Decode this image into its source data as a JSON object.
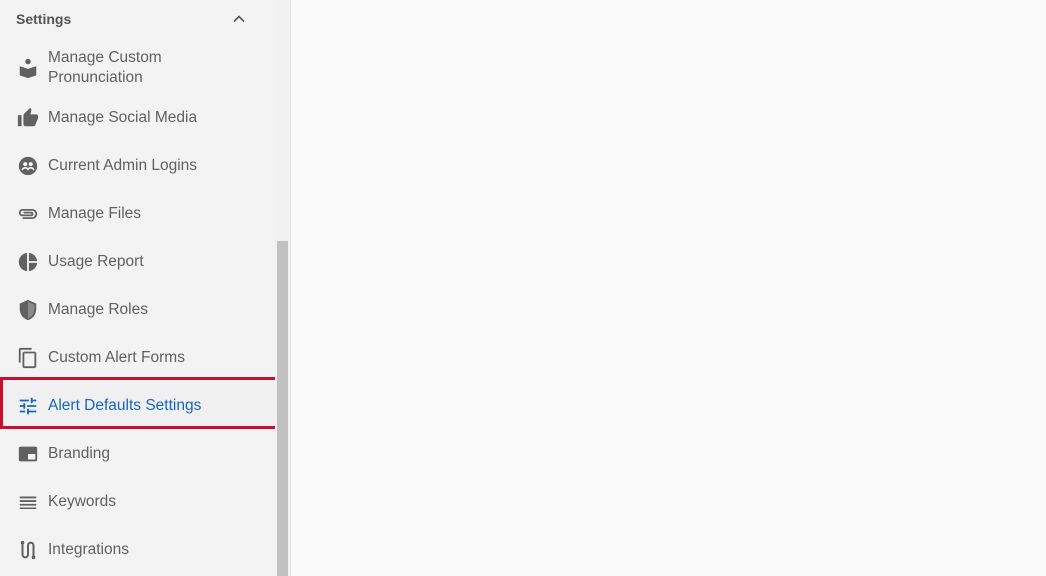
{
  "sidebar": {
    "section_title": "Settings",
    "items": [
      {
        "label": "Manage Custom Pronunciation",
        "icon": "book-reader-icon"
      },
      {
        "label": "Manage Social Media",
        "icon": "thumbs-up-icon"
      },
      {
        "label": "Current Admin Logins",
        "icon": "users-circle-icon"
      },
      {
        "label": "Manage Files",
        "icon": "paperclip-icon"
      },
      {
        "label": "Usage Report",
        "icon": "pie-chart-icon"
      },
      {
        "label": "Manage Roles",
        "icon": "shield-icon"
      },
      {
        "label": "Custom Alert Forms",
        "icon": "copy-icon"
      },
      {
        "label": "Alert Defaults Settings",
        "icon": "sliders-icon",
        "active": true
      },
      {
        "label": "Branding",
        "icon": "branding-icon"
      },
      {
        "label": "Keywords",
        "icon": "list-icon"
      },
      {
        "label": "Integrations",
        "icon": "route-icon"
      }
    ]
  },
  "colors": {
    "active_text": "#1565c0",
    "highlight_border": "#c8102e",
    "icon": "#616161"
  }
}
